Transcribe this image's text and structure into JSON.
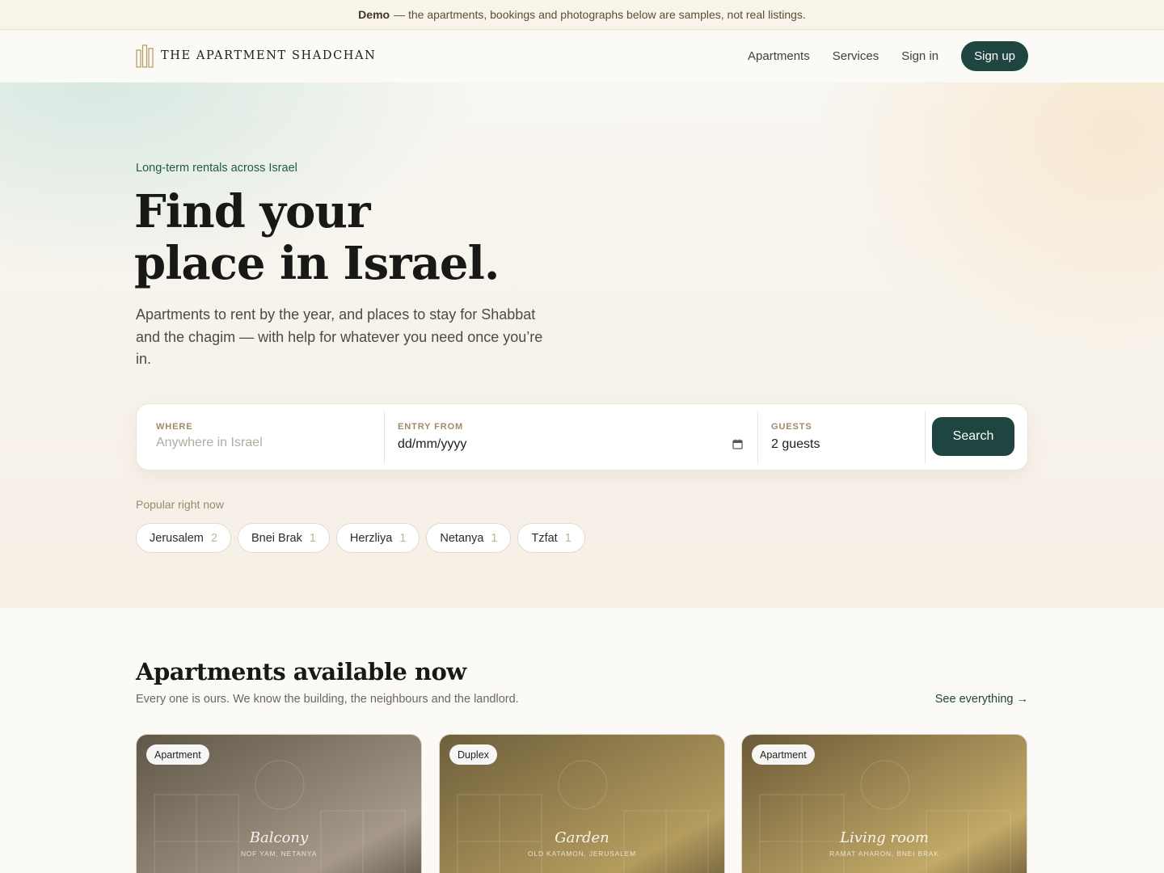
{
  "demo_banner": {
    "bold": "Demo",
    "text": "— the apartments, bookings and photographs below are samples, not real listings."
  },
  "header": {
    "logo_text": "THE APARTMENT SHADCHAN",
    "nav": [
      "Apartments",
      "Services",
      "Sign in"
    ],
    "signup_label": "Sign up"
  },
  "hero": {
    "eyebrow": "Long-term rentals across Israel",
    "title_line1": "Find your",
    "title_line2": "place in Israel.",
    "subtitle": "Apartments to rent by the year, and places to stay for Shabbat and the chagim — with help for whatever you need once you’re in."
  },
  "search": {
    "where_label": "WHERE",
    "where_placeholder": "Anywhere in Israel",
    "entry_label": "ENTRY FROM",
    "entry_value": "dd/mm/yyyy",
    "guests_label": "GUESTS",
    "guests_value": "2 guests",
    "button_label": "Search"
  },
  "popular": {
    "label": "Popular right now",
    "chips": [
      {
        "name": "Jerusalem",
        "count": "2"
      },
      {
        "name": "Bnei Brak",
        "count": "1"
      },
      {
        "name": "Herzliya",
        "count": "1"
      },
      {
        "name": "Netanya",
        "count": "1"
      },
      {
        "name": "Tzfat",
        "count": "1"
      }
    ]
  },
  "listings": {
    "title": "Apartments available now",
    "subtitle": "Every one is ours. We know the building, the neighbours and the landlord.",
    "see_all": "See everything →",
    "cards": [
      {
        "badge": "Apartment",
        "caption": "Balcony",
        "location": "NOF YAM, NETANYA",
        "color_a": "#5f5747",
        "color_b": "#a6998a"
      },
      {
        "badge": "Duplex",
        "caption": "Garden",
        "location": "OLD KATAMON, JERUSALEM",
        "color_a": "#6e5f3c",
        "color_b": "#b49c5e"
      },
      {
        "badge": "Apartment",
        "caption": "Living room",
        "location": "RAMAT AHARON, BNEI BRAK",
        "color_a": "#6c5a38",
        "color_b": "#c3aa68"
      }
    ]
  },
  "colors": {
    "brand_green": "#1f4540",
    "accent_gold": "#a08a68"
  }
}
